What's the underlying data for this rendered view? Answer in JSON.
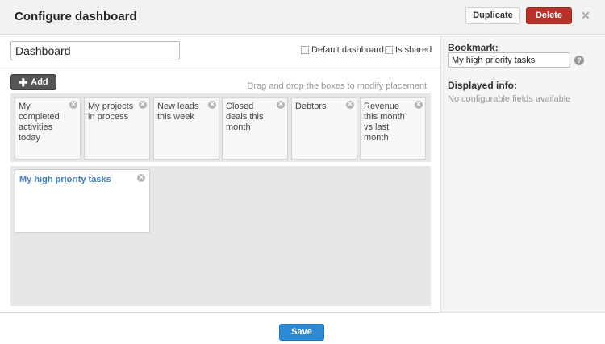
{
  "header": {
    "title": "Configure dashboard",
    "duplicate_label": "Duplicate",
    "delete_label": "Delete",
    "close_glyph": "✕"
  },
  "editor": {
    "name_value": "Dashboard",
    "default_dashboard_label": "Default dashboard",
    "is_shared_label": "Is shared",
    "add_label": "Add",
    "hint": "Drag and drop the boxes to modify placement"
  },
  "available_widgets": [
    {
      "label": "My completed activities today"
    },
    {
      "label": "My projects in process"
    },
    {
      "label": "New leads this week"
    },
    {
      "label": "Closed deals this month"
    },
    {
      "label": "Debtors"
    },
    {
      "label": "Revenue this month vs last month"
    }
  ],
  "placed_widgets": [
    {
      "label": "My high priority tasks"
    }
  ],
  "panel": {
    "bookmark_label": "Bookmark:",
    "bookmark_value": "My high priority tasks",
    "help_glyph": "?",
    "displayed_info_label": "Displayed info:",
    "no_fields_text": "No configurable fields available"
  },
  "footer": {
    "save_label": "Save"
  },
  "icons": {
    "plus": "plus-icon",
    "remove": "remove-circle-icon",
    "close": "close-icon",
    "help": "help-icon"
  },
  "colors": {
    "delete": "#b8342b",
    "save": "#2f8ad4",
    "widget_title": "#3f7fbd"
  }
}
